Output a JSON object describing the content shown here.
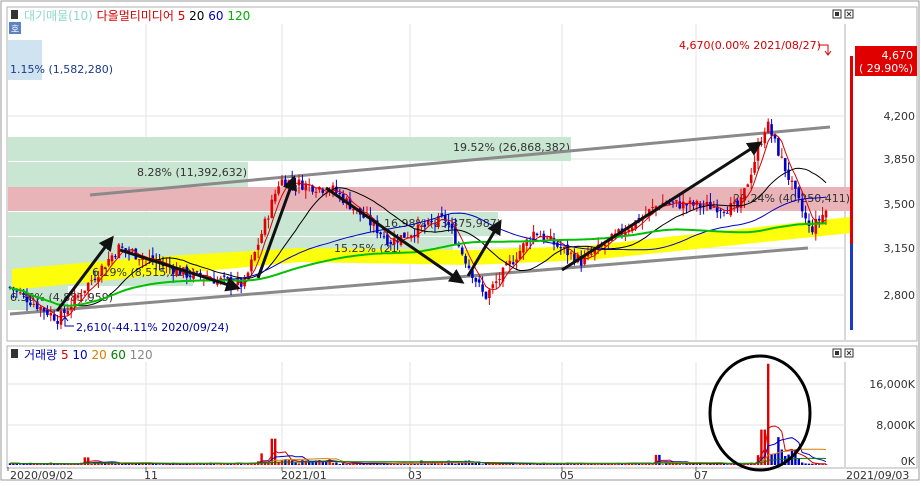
{
  "price_panel": {
    "legend": [
      {
        "text": "대기매물(10)",
        "color": "#8fd8c8"
      },
      {
        "text": "다올멀티미디어",
        "color": "#d40000"
      },
      {
        "text": "5",
        "color": "#d40000"
      },
      {
        "text": "20",
        "color": "#000000"
      },
      {
        "text": "60",
        "color": "#0000c0"
      },
      {
        "text": "120",
        "color": "#00b000"
      }
    ],
    "badge": "호",
    "current_price": "4,670",
    "current_change": "( 29.90%)",
    "high_annotation": "4,670(0.00% 2021/08/27)",
    "low_annotation": "2,610(-44.11% 2020/09/24)",
    "y_ticks": [
      "4,200",
      "3,850",
      "3,500",
      "3,150",
      "2,800"
    ],
    "overhang_labels": [
      "1.15% (1,582,280)",
      "19.52% (26,868,382)",
      "8.28% (11,392,632)",
      "29.24% (40,250,411)",
      "16.98% (23,375,987)",
      "15.25% (21,",
      "6.19% (8,515,220)",
      "6.36% (4,881,959)"
    ]
  },
  "volume_panel": {
    "legend": [
      {
        "text": "거래량",
        "color": "#0000c0"
      },
      {
        "text": "5",
        "color": "#d40000"
      },
      {
        "text": "10",
        "color": "#0000c0"
      },
      {
        "text": "20",
        "color": "#d08000"
      },
      {
        "text": "60",
        "color": "#008000"
      },
      {
        "text": "120",
        "color": "#888888"
      }
    ],
    "y_ticks": [
      "16,000K",
      "8,000K",
      "0K"
    ]
  },
  "x_axis": {
    "labels": [
      "2020/09/02",
      "11",
      "2021/01",
      "03",
      "05",
      "07",
      "2021/09/03"
    ]
  },
  "colors": {
    "up": "#e00000",
    "down": "#0000c8",
    "ma5": "#d40000",
    "ma20": "#000000",
    "ma60": "#0000c0",
    "ma120": "#00c000",
    "overhang": "#c8e6d2",
    "overhang_hot": "#e8b4b8",
    "highlight": "#ffff00"
  },
  "chart_data": {
    "type": "candlestick",
    "title": "다올멀티미디어",
    "y_axis": {
      "ticks": [
        4200,
        3850,
        3500,
        3150,
        2800
      ],
      "range": [
        2480,
        4760
      ]
    },
    "volume_axis": {
      "ticks": [
        16000,
        8000,
        0
      ],
      "unit": "K",
      "range": [
        0,
        22000
      ]
    },
    "x_axis": {
      "start": "2020/09/02",
      "end": "2021/09/03",
      "labels": [
        "2020/09/02",
        "11",
        "2021/01",
        "03",
        "05",
        "07",
        "2021/09/03"
      ]
    },
    "current": {
      "price": 4670,
      "change_pct": 29.9
    },
    "high": {
      "price": 4670,
      "pct": 0.0,
      "date": "2021/08/27"
    },
    "low": {
      "price": 2610,
      "pct": -44.11,
      "date": "2020/09/24"
    },
    "overhang_volume": [
      {
        "pct": 1.15,
        "volume": 1582280
      },
      {
        "pct": 19.52,
        "volume": 26868382
      },
      {
        "pct": 8.28,
        "volume": 11392632
      },
      {
        "pct": 29.24,
        "volume": 40250411
      },
      {
        "pct": 16.98,
        "volume": 23375987
      },
      {
        "pct": 15.25,
        "volume": null
      },
      {
        "pct": 6.19,
        "volume": 8515220
      },
      {
        "pct": 6.36,
        "volume": 4881959
      }
    ],
    "price_series": [
      {
        "date": "2020/09/02",
        "close": 2870
      },
      {
        "date": "2020/09/24",
        "close": 2610
      },
      {
        "date": "2020/10/20",
        "close": 3170
      },
      {
        "date": "2020/11/20",
        "close": 2960
      },
      {
        "date": "2020/12/15",
        "close": 2880
      },
      {
        "date": "2020/12/31",
        "close": 3700
      },
      {
        "date": "2021/01/25",
        "close": 3620
      },
      {
        "date": "2021/02/20",
        "close": 3220
      },
      {
        "date": "2021/03/15",
        "close": 3400
      },
      {
        "date": "2021/03/31",
        "close": 2780
      },
      {
        "date": "2021/04/20",
        "close": 3300
      },
      {
        "date": "2021/05/10",
        "close": 3060
      },
      {
        "date": "2021/06/15",
        "close": 3520
      },
      {
        "date": "2021/07/20",
        "close": 3480
      },
      {
        "date": "2021/08/01",
        "close": 4150
      },
      {
        "date": "2021/08/20",
        "close": 3300
      },
      {
        "date": "2021/09/03",
        "close": 3620
      }
    ]
  }
}
